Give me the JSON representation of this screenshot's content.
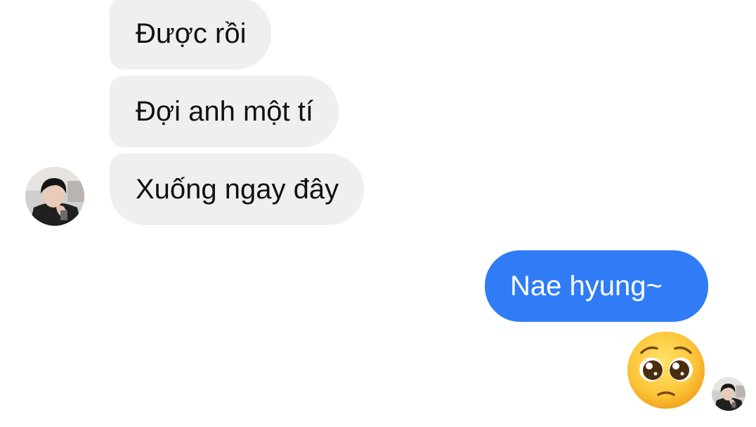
{
  "conversation": {
    "messages": [
      {
        "sender": "contact",
        "text": "Được rồi"
      },
      {
        "sender": "contact",
        "text": "Đợi anh một tí"
      },
      {
        "sender": "contact",
        "text": "Xuống ngay đây"
      },
      {
        "sender": "me",
        "text": "Nae hyung~"
      },
      {
        "sender": "me",
        "emoji": "pleading-face-emoji"
      }
    ],
    "contact_avatar_icon": "contact-avatar",
    "seen_indicator_icon": "seen-avatar"
  },
  "colors": {
    "incoming_bubble": "#efefef",
    "incoming_text": "#111111",
    "outgoing_bubble": "#2f7cf6",
    "outgoing_text": "#ffffff",
    "background": "#ffffff"
  }
}
